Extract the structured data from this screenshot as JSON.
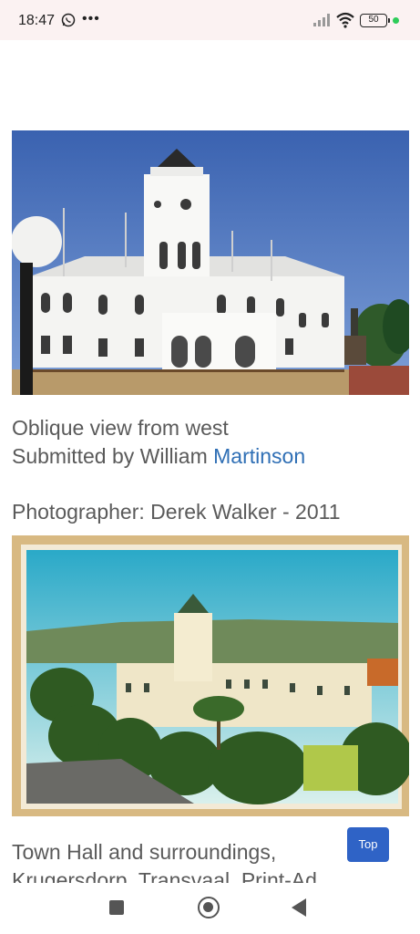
{
  "status_bar": {
    "time": "18:47",
    "battery": "50",
    "icons": [
      "whatsapp-icon",
      "more-icon",
      "signal-icon",
      "wifi-icon",
      "battery-icon",
      "notification-dot-icon"
    ]
  },
  "photos": [
    {
      "name": "town-hall-photo",
      "subject": "Oblique view of white town hall with clock tower"
    },
    {
      "name": "town-hall-postcard",
      "subject": "Postcard of Town Hall and surroundings"
    }
  ],
  "captions": {
    "line1": "Oblique view from west",
    "line2_prefix": "Submitted by William ",
    "line2_link": "Martinson",
    "photographer": "Photographer: Derek Walker - 2011",
    "postcard_line1": "Town Hall and surroundings,",
    "postcard_line2": "Krugersdorp, Transvaal. Print-Ad"
  },
  "top_button": {
    "label": "Top"
  },
  "nav_bar": {
    "icons": [
      "recents-icon",
      "home-icon",
      "back-icon"
    ]
  },
  "colors": {
    "link": "#2f6fb5",
    "button": "#2f63c6",
    "status_bg": "#fbf2f2"
  }
}
